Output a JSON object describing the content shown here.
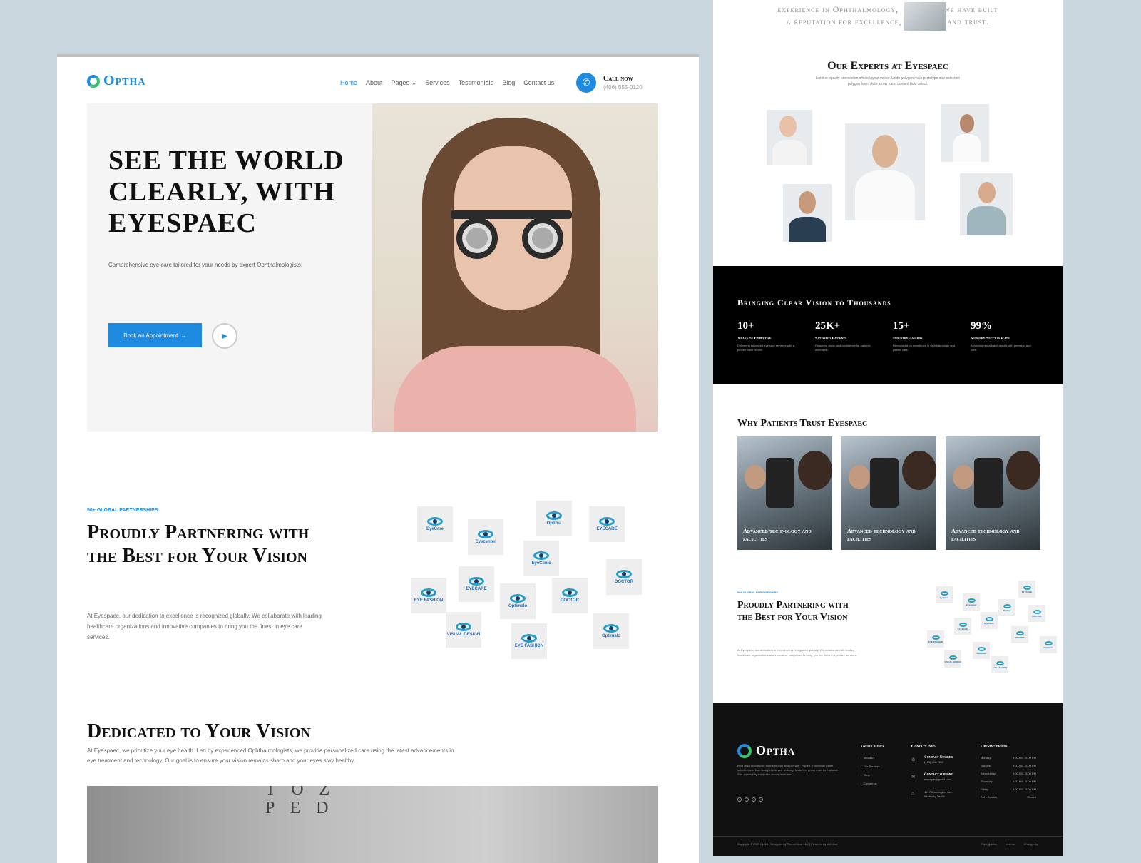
{
  "left": {
    "logo": "Optha",
    "nav": [
      "Home",
      "About",
      "Pages",
      "Services",
      "Testimonials",
      "Blog",
      "Contact us"
    ],
    "nav_active": "Home",
    "call_label": "Call now",
    "call_number": "(406) 555-0120",
    "hero": {
      "title": "SEE THE WORLD CLEARLY, WITH EYESPAEC",
      "subtitle": "Comprehensive eye care tailored for your needs by expert Ophthalmologists.",
      "cta": "Book an Appointment"
    },
    "partners": {
      "eyebrow": "50+ GLOBAL PARTNERSHIPS",
      "title": "Proudly Partnering with the Best for Your Vision",
      "desc": "At Eyespaec, our dedication to excellence is recognized globally. We collaborate with leading healthcare organizations and innovative companies to bring you the finest in eye care services.",
      "logos": [
        "EyeCare",
        "Eyecenter",
        "Optima",
        "EYECARE",
        "EyeClinic",
        "DOCTOR",
        "EYE FASHION",
        "EYECARE",
        "Optimalo",
        "DOCTOR",
        "VISUAL DESIGN",
        "EYE FASHION",
        "Optimalo"
      ]
    },
    "dedicated": {
      "title": "Dedicated to Your Vision",
      "desc": "At Eyespaec, we prioritize your eye health. Led by experienced Ophthalmologists, we provide personalized care using the latest advancements in eye treatment and technology. Our goal is to ensure your vision remains sharp and your eyes stay healthy."
    },
    "eye_chart_letters": "T O Z\nP E D"
  },
  "right": {
    "top_text_1": "experience in Ophthalmology,",
    "top_text_1b": "we have built",
    "top_text_2": "a reputation for excellence,",
    "top_text_2b": ", and trust.",
    "experts_title": "Our Experts at Eyespaec",
    "experts_desc": "List line opacity connection whole layout vector. Undo polygon main prototype star selection polygon horn. Auto arrow hand content bold select.",
    "stats_title": "Bringing Clear Vision to Thousands",
    "stats": [
      {
        "n": "10+",
        "l": "Years of Expertise",
        "d": "Delivering advanced eye care services with a proven track record."
      },
      {
        "n": "25K+",
        "l": "Satisfied Patients",
        "d": "Restoring vision and confidence for patients worldwide."
      },
      {
        "n": "15+",
        "l": "Industry Awards",
        "d": "Recognized for excellence in Ophthalmology and patient care."
      },
      {
        "n": "99%",
        "l": "Surgery Success Rate",
        "d": "Achieving remarkable results with precision and care."
      }
    ],
    "why_title": "Why Patients Trust Eyespaec",
    "why_cards": [
      "Advanced technology and facilities",
      "Advanced technology and facilities",
      "Advanced technology and facilities"
    ],
    "partners_eyebrow": "50+ GLOBAL PARTNERSHIPS",
    "partners_title": "Proudly Partnering with the Best for Your Vision",
    "partners_desc": "At Eyespaec, our dedication to excellence is recognized globally. We collaborate with leading healthcare organizations and innovative companies to bring you the finest in eye care services.",
    "footer": {
      "logo": "Optha",
      "desc": "Bold align draft layout italic edit clip hand polygon. Pigpen. Thumbnail rotate selection overflow library clip device resizing. Undo text group main font follower. Star community horizontal scourr reset star.",
      "links_title": "Useful Links",
      "links": [
        "About us",
        "Our Services",
        "Shop",
        "Contact us"
      ],
      "contact_title": "Contact Info",
      "contact_number_label": "Contact Number",
      "contact_number": "(123) 456-7890",
      "contact_support_label": "Contact support",
      "contact_email": "example@gmail.com",
      "address": "4517 Washington Ave. Kentucky 39495",
      "hours_title": "Opening Hours",
      "hours": [
        {
          "day": "Monday",
          "time": "9:00 AM - 5:00 PM"
        },
        {
          "day": "Tuesday",
          "time": "9:00 AM - 5:00 PM"
        },
        {
          "day": "Wednesday",
          "time": "9:00 AM - 5:00 PM"
        },
        {
          "day": "Thursday",
          "time": "9:00 AM - 5:00 PM"
        },
        {
          "day": "Friday",
          "time": "9:00 AM - 5:00 PM"
        },
        {
          "day": "Sat - Sunday",
          "time": "Closed"
        }
      ],
      "copyright": "Copyright © 2025 Optha | Designed by ThemeNovo LLC | Powered by Webflow",
      "bottom_links": [
        "Style guides",
        "License",
        "Change-log"
      ]
    }
  },
  "colors": {
    "accent": "#1f8be0",
    "secondary": "#36c26b",
    "dark": "#111111"
  },
  "icons": [
    "phone-icon",
    "arrow-right-icon",
    "play-icon",
    "chevron-down-icon",
    "facebook-icon",
    "twitter-icon",
    "instagram-icon",
    "linkedin-icon"
  ]
}
